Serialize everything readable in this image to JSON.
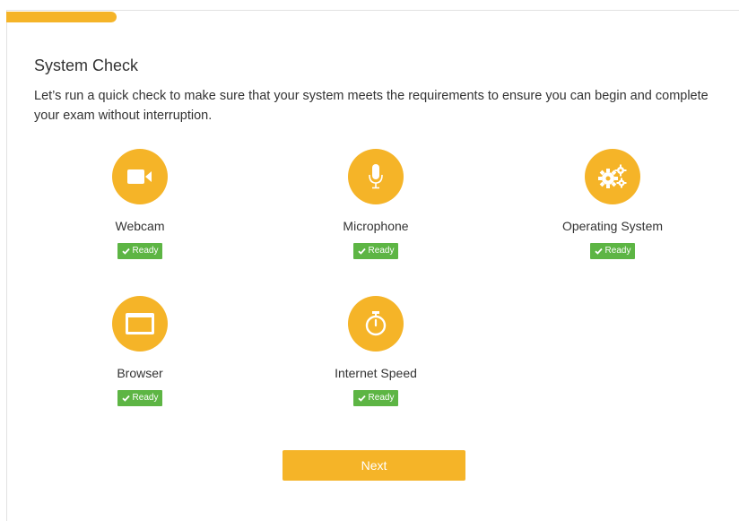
{
  "page": {
    "title": "System Check",
    "intro": "Let’s run a quick check to make sure that your system meets the requirements to ensure you can begin and complete your exam without interruption.",
    "accent_color": "#f5b428",
    "ready_color": "#5db544"
  },
  "progress": {
    "fraction": 0.15
  },
  "checks": {
    "webcam": {
      "label": "Webcam",
      "status": "Ready",
      "icon": "video-camera-icon"
    },
    "microphone": {
      "label": "Microphone",
      "status": "Ready",
      "icon": "microphone-icon"
    },
    "os": {
      "label": "Operating System",
      "status": "Ready",
      "icon": "gears-icon"
    },
    "browser": {
      "label": "Browser",
      "status": "Ready",
      "icon": "browser-window-icon"
    },
    "internet": {
      "label": "Internet Speed",
      "status": "Ready",
      "icon": "stopwatch-icon"
    }
  },
  "actions": {
    "next_label": "Next"
  }
}
